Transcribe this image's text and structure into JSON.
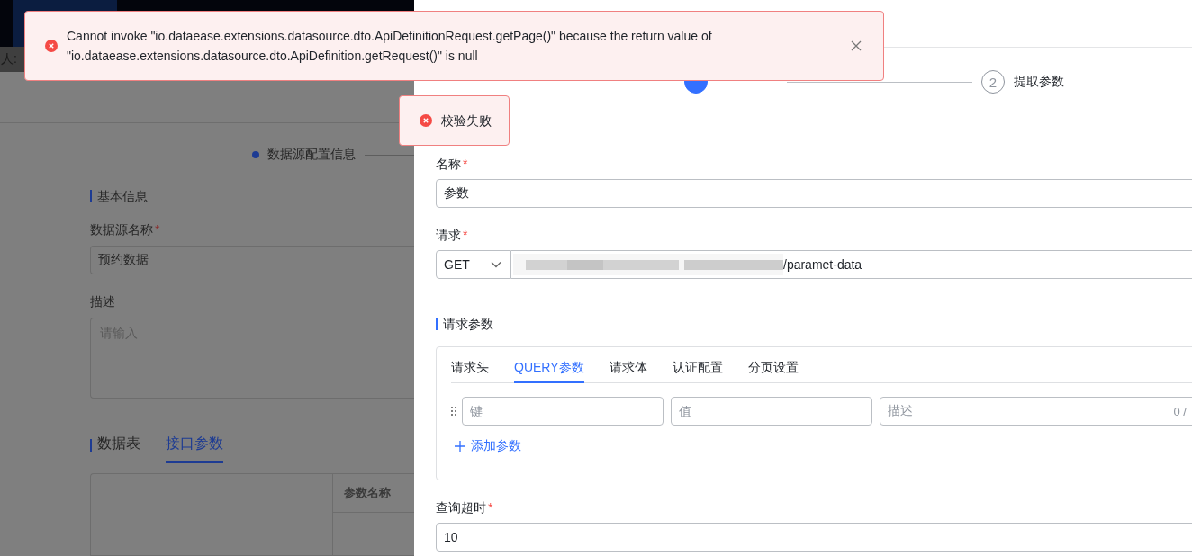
{
  "background_page": {
    "header_text": "人:",
    "stepper_label": "数据源配置信息",
    "section_title": "基本信息",
    "name_field": {
      "label": "数据源名称",
      "required_mark": "*",
      "value": "预约数据"
    },
    "description_field": {
      "label": "描述",
      "placeholder": "请输入"
    },
    "tabs": [
      {
        "label": "数据表",
        "selected": false
      },
      {
        "label": "接口参数",
        "selected": true
      }
    ],
    "table_header": "参数名称"
  },
  "drawer": {
    "steps": [
      {
        "active": true
      },
      {
        "number": "2",
        "label": "提取参数",
        "active": false
      }
    ],
    "name_field": {
      "label": "名称",
      "required_mark": "*",
      "value": "参数"
    },
    "request_field": {
      "label": "请求",
      "required_mark": "*",
      "method": "GET",
      "url": "/paramet-data"
    },
    "params_title": "请求参数",
    "tabs": [
      {
        "label": "请求头",
        "selected": false
      },
      {
        "label": "QUERY参数",
        "selected": true
      },
      {
        "label": "请求体",
        "selected": false
      },
      {
        "label": "认证配置",
        "selected": false
      },
      {
        "label": "分页设置",
        "selected": false
      }
    ],
    "param_row": {
      "key_placeholder": "键",
      "value_placeholder": "值",
      "description_placeholder": "描述",
      "count": "0 /"
    },
    "add_param": "添加参数",
    "timeout_field": {
      "label": "查询超时",
      "required_mark": "*",
      "value": "10"
    }
  },
  "toasts": [
    {
      "kind": "error",
      "message": "Cannot invoke \"io.dataease.extensions.datasource.dto.ApiDefinitionRequest.getPage()\" because the return value of \"io.dataease.extensions.datasource.dto.ApiDefinition.getRequest()\" is null",
      "closable": true
    },
    {
      "kind": "error",
      "message": "校验失败",
      "closable": false
    }
  ]
}
